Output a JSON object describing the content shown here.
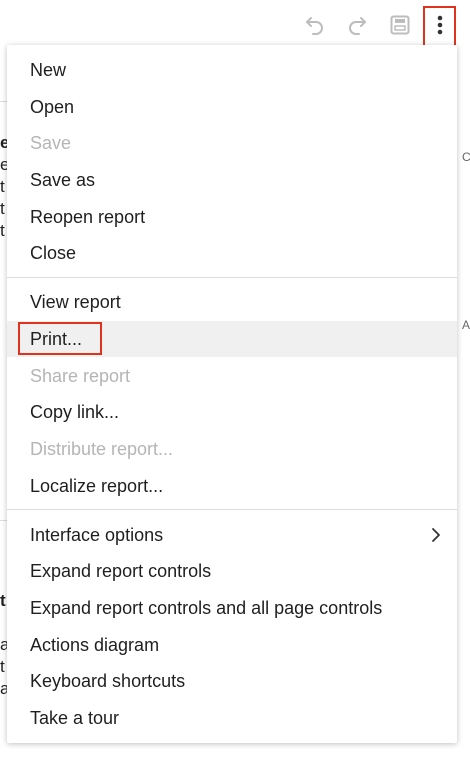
{
  "background": {
    "left_fragments": [
      "e",
      "e",
      "t",
      "t",
      "t",
      "t",
      "a",
      "t",
      "a"
    ],
    "right_fragments": [
      "C",
      "A"
    ]
  },
  "toolbar": {
    "undo_icon": "undo-icon",
    "redo_icon": "redo-icon",
    "save_icon": "save-icon",
    "more_icon": "more-vertical-icon"
  },
  "annotations": {
    "step1": "1",
    "step2": "2",
    "accent": "#e0321e"
  },
  "menu": {
    "group1": [
      {
        "label": "New",
        "disabled": false
      },
      {
        "label": "Open",
        "disabled": false
      },
      {
        "label": "Save",
        "disabled": true
      },
      {
        "label": "Save as",
        "disabled": false
      },
      {
        "label": "Reopen report",
        "disabled": false
      },
      {
        "label": "Close",
        "disabled": false
      }
    ],
    "group2": [
      {
        "label": "View report",
        "disabled": false
      },
      {
        "label": "Print...",
        "disabled": false
      },
      {
        "label": "Share report",
        "disabled": true
      },
      {
        "label": "Copy link...",
        "disabled": false
      },
      {
        "label": "Distribute report...",
        "disabled": true
      },
      {
        "label": "Localize report...",
        "disabled": false
      }
    ],
    "group3": [
      {
        "label": "Interface options",
        "disabled": false,
        "submenu": true
      },
      {
        "label": "Expand report controls",
        "disabled": false
      },
      {
        "label": "Expand report controls and all page controls",
        "disabled": false
      },
      {
        "label": "Actions diagram",
        "disabled": false
      },
      {
        "label": "Keyboard shortcuts",
        "disabled": false
      },
      {
        "label": "Take a tour",
        "disabled": false
      }
    ]
  }
}
